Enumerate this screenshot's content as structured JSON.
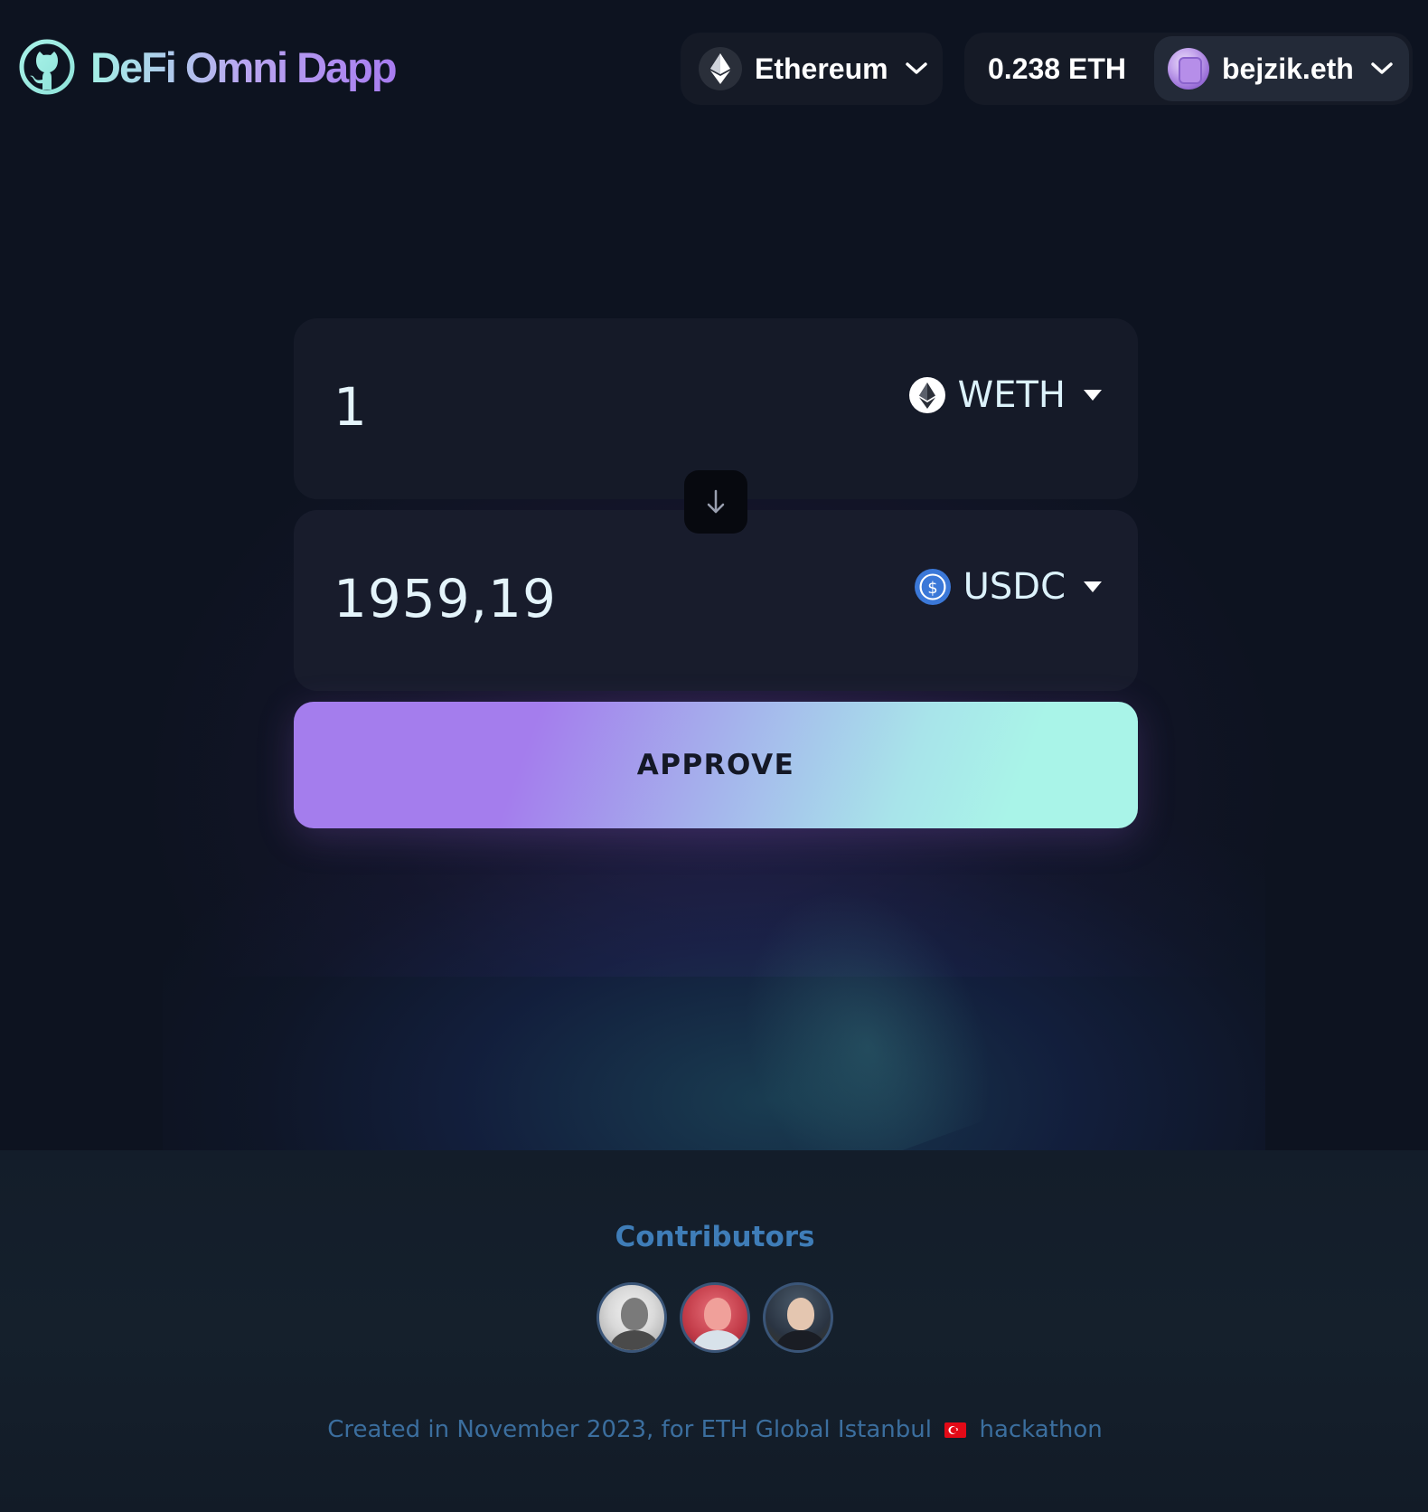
{
  "app": {
    "title": "DeFi Omni Dapp",
    "accent_gradient": [
      "#a3f0e6",
      "#b9a6f0",
      "#a77cf0"
    ],
    "background": "#0d1320"
  },
  "header": {
    "logo_icon": "github-icon",
    "network": {
      "label": "Ethereum",
      "icon": "ethereum-icon"
    },
    "balance": "0.238 ETH",
    "account": {
      "label": "bejzik.eth",
      "icon": "account-avatar"
    }
  },
  "swap": {
    "from": {
      "amount": "1",
      "token": "WETH",
      "icon": "ethereum-icon"
    },
    "to": {
      "amount": "1959,19",
      "token": "USDC",
      "icon": "usdc-icon"
    },
    "flip_icon": "arrow-down-icon",
    "approve_label": "APPROVE",
    "approve_gradient": [
      "#a47ded",
      "#a9f4e8"
    ]
  },
  "footer": {
    "contributors_title": "Contributors",
    "contributors": [
      {
        "name": "contributor-1"
      },
      {
        "name": "contributor-2"
      },
      {
        "name": "contributor-3"
      }
    ],
    "credit_prefix": "Created in November 2023, for ETH Global Istanbul",
    "credit_suffix": "hackathon",
    "credit_flag": "turkey-flag-icon"
  }
}
